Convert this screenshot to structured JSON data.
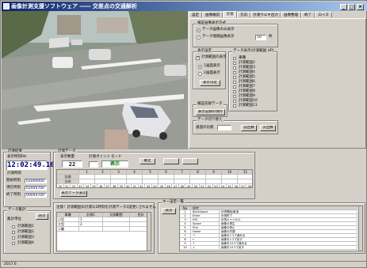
{
  "window": {
    "title": "画像計測支援ソフトウェア ―― 交差点の交通解析"
  },
  "tabs": [
    "設定",
    "画像確認",
    "計測",
    "方向",
    "計測ウエキ出力",
    "画像整理",
    "終了",
    "ロイズ"
  ],
  "settings": {
    "display_mode_title": "検証画像表示方式",
    "display_opt1": "データ画像のみ表示",
    "display_opt2": "データ間隔画像表示",
    "display_interval": "10",
    "display_unit": "秒",
    "display_settings_title": "表示設定",
    "measure_display_check": "計測範囲の表示",
    "one_screen": "1画面表示",
    "two_screen": "2画面表示",
    "display_button": "表示決定",
    "data_display_title": "データ表示(計測範囲 UP)",
    "range_items": [
      "車種",
      "計測範囲2",
      "計測範囲3",
      "計測範囲4",
      "計測範囲5",
      "計測範囲6",
      "計測範囲7",
      "計測範囲8",
      "計測範囲9",
      "計測範囲10",
      "計測範囲11"
    ],
    "file_title": "検証記録データ",
    "file_button": "表示記録の保存",
    "switch_title": "データ切り替え",
    "switch_label": "通過の比較",
    "prev_button": "前回数",
    "next_button": "次回数"
  },
  "bottom": {
    "result_title": "計測結果",
    "time_label": "表示時刻R6",
    "time_value": "12:02:49.16",
    "sub_time_title": "計測時刻",
    "rows": [
      {
        "label": "開始時刻",
        "value": "02000000"
      },
      {
        "label": "現在時刻",
        "value": "02444700"
      },
      {
        "label": "終了時刻",
        "value": "00044700"
      }
    ],
    "data_count_title": "データ集計",
    "count_label": "集計単位",
    "count_items": [
      "計測範囲1",
      "計測範囲2",
      "計測範囲3",
      "計測範囲4"
    ],
    "count_display_btn": "表示",
    "method_title": "計測データ",
    "display_count_label": "表示数量",
    "count_value": "22",
    "measure_point_label": "計測ポイント",
    "mode_label": "モード",
    "mode_value": "表示",
    "confirm_btn": "確定",
    "grid_headers": [
      "1",
      "2",
      "3",
      "4",
      "5",
      "6",
      "7",
      "8",
      "9",
      "10",
      "11"
    ],
    "grid_row_labels": [
      "計測",
      "方向",
      "車種"
    ],
    "grid_values": [
      "30",
      "31",
      "32",
      "33",
      "34",
      "35",
      "36",
      "37",
      "38",
      "39",
      "40",
      "41",
      "42",
      "43",
      "44",
      "45",
      "46",
      "47",
      "48",
      "49",
      "50",
      "51",
      "52",
      "53",
      "54",
      "55",
      "56",
      "57",
      "58"
    ],
    "data_list_btn": "表示データ表示",
    "note": "注意！計測範囲の計測1(2時刻を計測データ3変更) されません",
    "summary_headers": [
      "車種",
      "計測1",
      "計測範囲",
      "合計"
    ],
    "summary_rows": [
      [
        "小型",
        "1",
        "",
        ""
      ],
      [
        "大型",
        "3",
        "",
        ""
      ],
      [
        "二輪",
        "",
        "",
        ""
      ]
    ],
    "keylist_title": "キー設定一覧",
    "keylist_btn": "表示",
    "keylist_headers": [
      "No",
      "設定"
    ],
    "keylist_rows": [
      [
        "1",
        "BackSpace",
        "計測開始/取消"
      ],
      [
        "2",
        "Enter",
        "計測終了"
      ],
      [
        "3",
        "ESC",
        "計測キャンセル"
      ],
      [
        "4",
        "Space",
        "画像の再生"
      ],
      [
        "5",
        "End",
        "画像の停止"
      ],
      [
        "6",
        "Home",
        "画像の先頭"
      ],
      [
        "7",
        "→",
        "画像を1コマ進める"
      ],
      [
        "8",
        "←",
        "画像を1コマ戻す"
      ],
      [
        "9",
        "↑",
        "画像を10コマ進める"
      ],
      [
        "10",
        "↓",
        "画像を10コマ戻す"
      ]
    ],
    "status": "2017.6"
  },
  "colors": {
    "title_start": "#0a246a",
    "title_end": "#a6caf0",
    "face": "#d4d0c8",
    "lcd_blue": "#000080",
    "green": "#008000"
  }
}
